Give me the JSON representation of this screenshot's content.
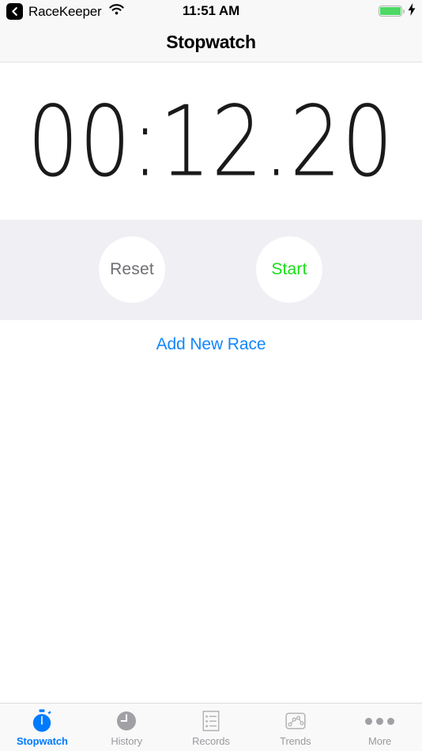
{
  "status_bar": {
    "back_icon": "back-chevron-icon",
    "app_name": "RaceKeeper",
    "wifi_icon": "wifi-icon",
    "time": "11:51 AM",
    "battery_icon": "battery-full-icon",
    "charging_icon": "lightning-bolt-icon",
    "battery_color": "#4CD964"
  },
  "nav_bar": {
    "title": "Stopwatch"
  },
  "timer": {
    "display": "00:12.20",
    "minutes": "00",
    "seconds": "12",
    "hundredths": "20"
  },
  "controls": {
    "reset_label": "Reset",
    "reset_color": "#6E6E73",
    "start_label": "Start",
    "start_color": "#17E017",
    "band_color": "#EFEFF4"
  },
  "actions": {
    "add_new_race_label": "Add New Race",
    "link_color": "#1287FB"
  },
  "tab_bar": {
    "active_color": "#007AFF",
    "inactive_color": "#9A9A9F",
    "tabs": [
      {
        "label": "Stopwatch",
        "icon": "stopwatch-icon",
        "active": true
      },
      {
        "label": "History",
        "icon": "clock-icon",
        "active": false
      },
      {
        "label": "Records",
        "icon": "starred-list-icon",
        "active": false
      },
      {
        "label": "Trends",
        "icon": "line-chart-icon",
        "active": false
      },
      {
        "label": "More",
        "icon": "ellipsis-icon",
        "active": false
      }
    ]
  }
}
